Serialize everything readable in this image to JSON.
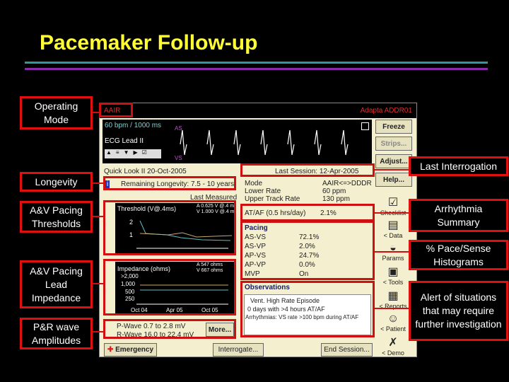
{
  "title": "Pacemaker Follow-up",
  "callouts": {
    "operating_mode": "Operating Mode",
    "longevity": "Longevity",
    "thresholds": "A&V Pacing Thresholds",
    "impedance": "A&V Pacing Lead Impedance",
    "waves": "P&R wave Amplitudes",
    "last_interrogation": "Last Interrogation",
    "arrhythmia": "Arrhythmia Summary",
    "pace_sense": "% Pace/Sense Histograms",
    "alert": "Alert of situations that may require further investigation"
  },
  "app": {
    "mode_label": "AAIR",
    "device": "Adapta ADDR01",
    "ecg_rate": "60 bpm / 1000 ms",
    "ecg_lead": "ECG Lead II",
    "ecg_markers": [
      "AS",
      "VS"
    ],
    "buttons": {
      "freeze": "Freeze",
      "strips": "Strips...",
      "adjust": "Adjust...",
      "help": "Help...",
      "more": "More...",
      "emergency": "Emergency",
      "interrogate": "Interrogate...",
      "end_session": "End Session..."
    },
    "quick_look": "Quick Look II  20-Oct-2005",
    "last_session": "Last Session: 12-Apr-2005",
    "longevity": "Remaining Longevity: 7.5 - 10 years",
    "last_measured": "Last Measured",
    "params": [
      {
        "k": "Mode",
        "v": "AAIR<=>DDDR"
      },
      {
        "k": "Lower Rate",
        "v": "60 ppm"
      },
      {
        "k": "Upper Track Rate",
        "v": "130 ppm"
      }
    ],
    "threshold": {
      "title": "Threshold (V@.4ms)",
      "legend": [
        "A  0.625 V @.4 ms",
        "V  1.000 V @.4 ms"
      ],
      "yticks": [
        "2",
        "1"
      ]
    },
    "impedance": {
      "title": "Impedance (ohms)",
      "legend": [
        "A  547 ohms",
        "V  667 ohms"
      ],
      "yticks": [
        ">2,000",
        "1,000",
        "500",
        "250"
      ],
      "xticks": [
        "Oct 04",
        "Apr 05",
        "Oct 05"
      ]
    },
    "ataf": {
      "label": "AT/AF (0.5 hrs/day)",
      "value": "2.1%"
    },
    "pacing": {
      "title": "Pacing",
      "rows": [
        {
          "k": "AS-VS",
          "v": "72.1%"
        },
        {
          "k": "AS-VP",
          "v": "2.0%"
        },
        {
          "k": "AP-VS",
          "v": "24.7%"
        },
        {
          "k": "AP-VP",
          "v": "0.0%"
        },
        {
          "k": "MVP",
          "v": "On"
        }
      ]
    },
    "observations": {
      "title": "Observations",
      "items": [
        "Vent. High Rate Episode",
        "0 days with >4 hours AT/AF",
        "Arrhythmias: VS rate >100 bpm during AT/AF"
      ]
    },
    "waves": {
      "p": "P-Wave   0.7 to 2.8 mV",
      "r": "R-Wave   16.0 to 22.4 mV"
    },
    "side_icons": [
      "Checklist",
      "< Data",
      "Params",
      "< Tools",
      "< Reports",
      "< Patient",
      "< Demo"
    ]
  },
  "colors": {
    "title": "#ffff33",
    "callout_border": "#e01010",
    "panel": "#f4efcf",
    "atrial_trace": "#5fc0c0",
    "ventricular_trace": "#c8a870"
  }
}
